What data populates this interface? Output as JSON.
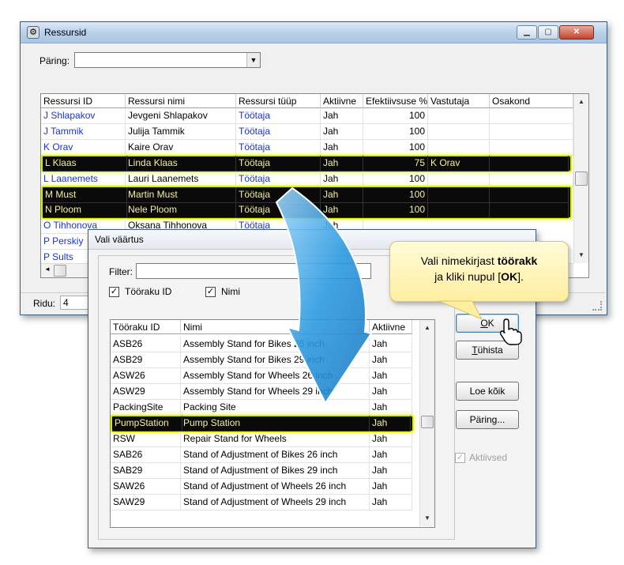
{
  "main_window": {
    "title": "Ressursid",
    "query_label": "Päring:",
    "query_value": "",
    "columns": [
      "Ressursi ID",
      "Ressursi nimi",
      "Ressursi tüüp",
      "Aktiivne",
      "Efektiivsuse %",
      "Vastutaja",
      "Osakond"
    ],
    "rows": [
      [
        "J Shlapakov",
        "Jevgeni Shlapakov",
        "Töötaja",
        "Jah",
        "100",
        "",
        ""
      ],
      [
        "J Tammik",
        "Julija Tammik",
        "Töötaja",
        "Jah",
        "100",
        "",
        ""
      ],
      [
        "K Orav",
        "Kaire Orav",
        "Töötaja",
        "Jah",
        "100",
        "",
        ""
      ],
      [
        "L Klaas",
        "Linda Klaas",
        "Töötaja",
        "Jah",
        "75",
        "K Orav",
        ""
      ],
      [
        "L Laanemets",
        "Lauri Laanemets",
        "Töötaja",
        "Jah",
        "100",
        "",
        ""
      ],
      [
        "M Must",
        "Martin Must",
        "Töötaja",
        "Jah",
        "100",
        "",
        ""
      ],
      [
        "N Ploom",
        "Nele Ploom",
        "Töötaja",
        "Jah",
        "100",
        "",
        ""
      ],
      [
        "O Tihhonova",
        "Oksana Tihhonova",
        "Töötaja",
        "Jah",
        "",
        "",
        ""
      ],
      [
        "P Perskiy",
        "",
        "",
        "",
        "",
        "",
        ""
      ],
      [
        "P Sults",
        "",
        "",
        "",
        "",
        "",
        ""
      ]
    ],
    "rows_label": "Ridu:",
    "rows_value": "4"
  },
  "dialog": {
    "title": "Vali väärtus",
    "filter_label": "Filter:",
    "filter_value": "",
    "checkbox_id_label": "Tööraku ID",
    "checkbox_name_label": "Nimi",
    "columns": [
      "Tööraku ID",
      "Nimi",
      "Aktiivne"
    ],
    "rows": [
      [
        "ASB26",
        "Assembly Stand for Bikes 26 inch",
        "Jah"
      ],
      [
        "ASB29",
        "Assembly Stand for Bikes 29 inch",
        "Jah"
      ],
      [
        "ASW26",
        "Assembly Stand for Wheels 26 inch",
        "Jah"
      ],
      [
        "ASW29",
        "Assembly Stand for Wheels 29 inch",
        "Jah"
      ],
      [
        "PackingSite",
        "Packing Site",
        "Jah"
      ],
      [
        "PumpStation",
        "Pump Station",
        "Jah"
      ],
      [
        "RSW",
        "Repair Stand for Wheels",
        "Jah"
      ],
      [
        "SAB26",
        "Stand of Adjustment of Bikes 26 inch",
        "Jah"
      ],
      [
        "SAB29",
        "Stand of Adjustment of Bikes 29 inch",
        "Jah"
      ],
      [
        "SAW26",
        "Stand of Adjustment of Wheels 26 inch",
        "Jah"
      ],
      [
        "SAW29",
        "Stand of Adjustment of Wheels 29 inch",
        "Jah"
      ]
    ],
    "buttons": {
      "ok_underline": "O",
      "ok_rest": "K",
      "cancel_underline": "T",
      "cancel_rest": "ühista",
      "load_all": "Loe kõik",
      "query": "Päring..."
    },
    "active_label": "Aktiivsed"
  },
  "callout": {
    "text_before": "Vali nimekirjast ",
    "text_bold": "töörakk",
    "text_middle": " ja kliki nupul [",
    "text_bold2": "OK",
    "text_after": "]."
  },
  "colors": {
    "highlight_border": "#d8f000",
    "link_blue": "#1a35c8",
    "arrow_blue": "#2e9be0",
    "callout_fill": "#fff3b0"
  }
}
